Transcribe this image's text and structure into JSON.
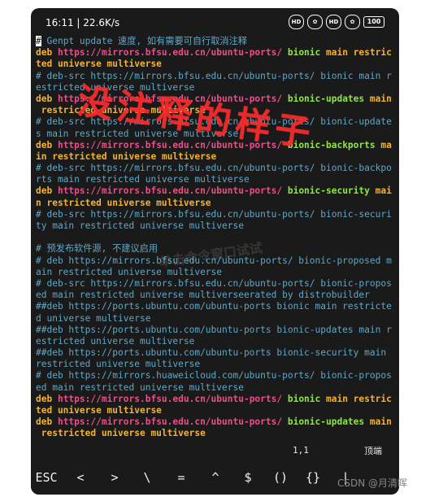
{
  "status_bar": {
    "time_speed": "16:11 | 22.6K/s",
    "icons": [
      "hd-icon",
      "flower-icon",
      "hd-icon",
      "flower-icon",
      "battery-icon"
    ],
    "hd_label": "HD",
    "battery": "100"
  },
  "terminal": {
    "lines": [
      [
        {
          "t": "#",
          "c": "cursor"
        },
        {
          "t": " Genpt update 速度, 如有需要可自行取消注释",
          "c": "comment"
        }
      ],
      [
        {
          "t": "deb ",
          "c": "deb"
        },
        {
          "t": "https://mirrors.bfsu.edu.cn/ubuntu-ports/ ",
          "c": "url"
        },
        {
          "t": "bionic ",
          "c": "dist"
        },
        {
          "t": "main restric",
          "c": "comp"
        }
      ],
      [
        {
          "t": "ted universe multiverse",
          "c": "comp"
        }
      ],
      [
        {
          "t": "# deb-src https://mirrors.bfsu.edu.cn/ubuntu-ports/ bionic main r",
          "c": "comment"
        }
      ],
      [
        {
          "t": "estricted universe multiverse",
          "c": "comment"
        }
      ],
      [
        {
          "t": "deb ",
          "c": "deb"
        },
        {
          "t": "https://mirrors.bfsu.edu.cn/ubuntu-ports/ ",
          "c": "url"
        },
        {
          "t": "bionic-updates ",
          "c": "dist"
        },
        {
          "t": "main",
          "c": "comp"
        }
      ],
      [
        {
          "t": " restricted universe multiverse",
          "c": "comp"
        }
      ],
      [
        {
          "t": "# deb-src https://mirrors.bfsu.edu.cn/ubuntu-ports/ bionic-update",
          "c": "comment"
        }
      ],
      [
        {
          "t": "s main restricted universe multiverse",
          "c": "comment"
        }
      ],
      [
        {
          "t": "deb ",
          "c": "deb"
        },
        {
          "t": "https://mirrors.bfsu.edu.cn/ubuntu-ports/ ",
          "c": "url"
        },
        {
          "t": "bionic-backports ",
          "c": "dist"
        },
        {
          "t": "ma",
          "c": "comp"
        }
      ],
      [
        {
          "t": "in restricted universe multiverse",
          "c": "comp"
        }
      ],
      [
        {
          "t": "# deb-src https://mirrors.bfsu.edu.cn/ubuntu-ports/ bionic-backpo",
          "c": "comment"
        }
      ],
      [
        {
          "t": "rts main restricted universe multiverse",
          "c": "comment"
        }
      ],
      [
        {
          "t": "deb ",
          "c": "deb"
        },
        {
          "t": "https://mirrors.bfsu.edu.cn/ubuntu-ports/ ",
          "c": "url"
        },
        {
          "t": "bionic-security ",
          "c": "dist"
        },
        {
          "t": "mai",
          "c": "comp"
        }
      ],
      [
        {
          "t": "n restricted universe multiverse",
          "c": "comp"
        }
      ],
      [
        {
          "t": "# deb-src https://mirrors.bfsu.edu.cn/ubuntu-ports/ bionic-securi",
          "c": "comment"
        }
      ],
      [
        {
          "t": "ty main restricted universe multiverse",
          "c": "comment"
        }
      ],
      [
        {
          "t": "",
          "c": "plain"
        }
      ],
      [
        {
          "t": "# 预发布软件源, 不建议启用",
          "c": "comment"
        }
      ],
      [
        {
          "t": "# deb https://mirrors.bfsu.edu.cn/ubuntu-ports/ bionic-proposed m",
          "c": "comment"
        }
      ],
      [
        {
          "t": "ain restricted universe multiverse",
          "c": "comment"
        }
      ],
      [
        {
          "t": "# deb-src https://mirrors.bfsu.edu.cn/ubuntu-ports/ bionic-propos",
          "c": "comment"
        }
      ],
      [
        {
          "t": "ed main restricted universe multiverseerated by distrobuilder",
          "c": "comment"
        }
      ],
      [
        {
          "t": "##deb https://ports.ubuntu.com/ubuntu-ports bionic main restricte",
          "c": "comment"
        }
      ],
      [
        {
          "t": "d universe multiverse",
          "c": "comment"
        }
      ],
      [
        {
          "t": "##deb https://ports.ubuntu.com/ubuntu-ports bionic-updates main r",
          "c": "comment"
        }
      ],
      [
        {
          "t": "estricted universe multiverse",
          "c": "comment"
        }
      ],
      [
        {
          "t": "##deb https://ports.ubuntu.com/ubuntu-ports bionic-security main",
          "c": "comment"
        }
      ],
      [
        {
          "t": "restricted universe multiverse",
          "c": "comment"
        }
      ],
      [
        {
          "t": "# deb https://mirrors.huaweicloud.com/ubuntu-ports/ bionic-propos",
          "c": "comment"
        }
      ],
      [
        {
          "t": "ed main restricted universe multiverse",
          "c": "comment"
        }
      ],
      [
        {
          "t": "deb ",
          "c": "deb"
        },
        {
          "t": "https://mirrors.bfsu.edu.cn/ubuntu-ports/ ",
          "c": "url"
        },
        {
          "t": "bionic ",
          "c": "dist"
        },
        {
          "t": "main restric",
          "c": "comp"
        }
      ],
      [
        {
          "t": "ted universe multiverse",
          "c": "comp"
        }
      ],
      [
        {
          "t": "deb ",
          "c": "deb"
        },
        {
          "t": "https://mirrors.bfsu.edu.cn/ubuntu-ports/ ",
          "c": "url"
        },
        {
          "t": "bionic-updates ",
          "c": "dist"
        },
        {
          "t": "main",
          "c": "comp"
        }
      ],
      [
        {
          "t": " restricted universe multiverse",
          "c": "comp"
        }
      ]
    ],
    "cursor_position": "1,1",
    "scroll_state": "顶端"
  },
  "annotation": "没注释的样子",
  "watermark_mid": "单击命令窗口试试",
  "watermark_corner": "CSDN @月清晖",
  "keybar": {
    "keys": [
      "ESC",
      "<",
      ">",
      "\\",
      "=",
      "^",
      "$",
      "()",
      "{}",
      "|"
    ]
  },
  "colors": {
    "background": "#1a1a1a",
    "comment": "#5fa8c8",
    "deb": "#f2b233",
    "url": "#e64f8a",
    "dist": "#8ee645",
    "annotation": "#ff2a2a"
  }
}
